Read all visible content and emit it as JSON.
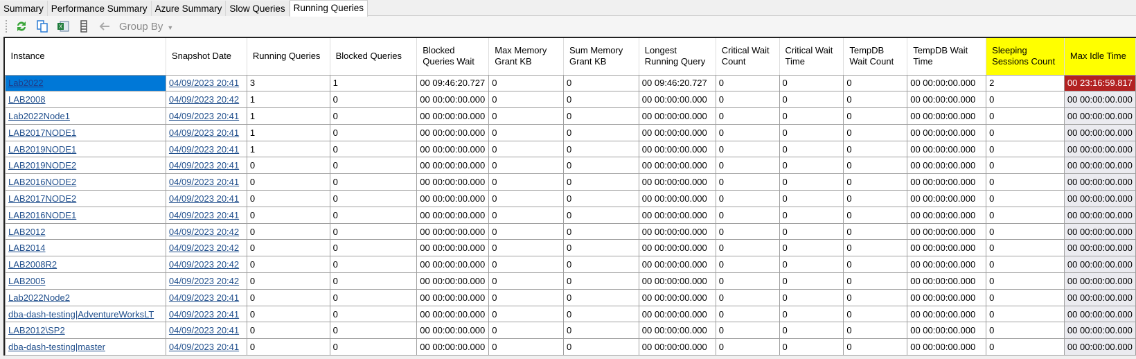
{
  "tabs": [
    {
      "label": "Summary"
    },
    {
      "label": "Performance Summary"
    },
    {
      "label": "Azure Summary"
    },
    {
      "label": "Slow Queries"
    },
    {
      "label": "Running Queries",
      "active": true
    }
  ],
  "toolbar": {
    "icons": [
      "refresh-icon",
      "copy-icon",
      "excel-export-icon",
      "columns-icon",
      "back-arrow-icon"
    ],
    "group_by": "Group By"
  },
  "colors": {
    "highlight_header": "#ffff00",
    "alert_cell": "#b22222",
    "selected_cell": "#0078d7"
  },
  "columns": [
    "Instance",
    "Snapshot Date",
    "Running Queries",
    "Blocked Queries",
    "Blocked Queries Wait",
    "Max Memory Grant KB",
    "Sum Memory Grant KB",
    "Longest Running Query",
    "Critical Wait Count",
    "Critical Wait Time",
    "TempDB Wait Count",
    "TempDB Wait Time",
    "Sleeping Sessions Count",
    "Max Idle Time"
  ],
  "rows": [
    [
      "Lab2022",
      "04/09/2023 20:41",
      "3",
      "1",
      "00 09:46:20.727",
      "0",
      "0",
      "00 09:46:20.727",
      "0",
      "0",
      "0",
      "00 00:00:00.000",
      "2",
      "00 23:16:59.817"
    ],
    [
      "LAB2008",
      "04/09/2023 20:42",
      "1",
      "0",
      "00 00:00:00.000",
      "0",
      "0",
      "00 00:00:00.000",
      "0",
      "0",
      "0",
      "00 00:00:00.000",
      "0",
      "00 00:00:00.000"
    ],
    [
      "Lab2022Node1",
      "04/09/2023 20:41",
      "1",
      "0",
      "00 00:00:00.000",
      "0",
      "0",
      "00 00:00:00.000",
      "0",
      "0",
      "0",
      "00 00:00:00.000",
      "0",
      "00 00:00:00.000"
    ],
    [
      "LAB2017NODE1",
      "04/09/2023 20:41",
      "1",
      "0",
      "00 00:00:00.000",
      "0",
      "0",
      "00 00:00:00.000",
      "0",
      "0",
      "0",
      "00 00:00:00.000",
      "0",
      "00 00:00:00.000"
    ],
    [
      "LAB2019NODE1",
      "04/09/2023 20:41",
      "1",
      "0",
      "00 00:00:00.000",
      "0",
      "0",
      "00 00:00:00.000",
      "0",
      "0",
      "0",
      "00 00:00:00.000",
      "0",
      "00 00:00:00.000"
    ],
    [
      "LAB2019NODE2",
      "04/09/2023 20:41",
      "0",
      "0",
      "00 00:00:00.000",
      "0",
      "0",
      "00 00:00:00.000",
      "0",
      "0",
      "0",
      "00 00:00:00.000",
      "0",
      "00 00:00:00.000"
    ],
    [
      "LAB2016NODE2",
      "04/09/2023 20:41",
      "0",
      "0",
      "00 00:00:00.000",
      "0",
      "0",
      "00 00:00:00.000",
      "0",
      "0",
      "0",
      "00 00:00:00.000",
      "0",
      "00 00:00:00.000"
    ],
    [
      "LAB2017NODE2",
      "04/09/2023 20:41",
      "0",
      "0",
      "00 00:00:00.000",
      "0",
      "0",
      "00 00:00:00.000",
      "0",
      "0",
      "0",
      "00 00:00:00.000",
      "0",
      "00 00:00:00.000"
    ],
    [
      "LAB2016NODE1",
      "04/09/2023 20:41",
      "0",
      "0",
      "00 00:00:00.000",
      "0",
      "0",
      "00 00:00:00.000",
      "0",
      "0",
      "0",
      "00 00:00:00.000",
      "0",
      "00 00:00:00.000"
    ],
    [
      "LAB2012",
      "04/09/2023 20:42",
      "0",
      "0",
      "00 00:00:00.000",
      "0",
      "0",
      "00 00:00:00.000",
      "0",
      "0",
      "0",
      "00 00:00:00.000",
      "0",
      "00 00:00:00.000"
    ],
    [
      "LAB2014",
      "04/09/2023 20:42",
      "0",
      "0",
      "00 00:00:00.000",
      "0",
      "0",
      "00 00:00:00.000",
      "0",
      "0",
      "0",
      "00 00:00:00.000",
      "0",
      "00 00:00:00.000"
    ],
    [
      "LAB2008R2",
      "04/09/2023 20:42",
      "0",
      "0",
      "00 00:00:00.000",
      "0",
      "0",
      "00 00:00:00.000",
      "0",
      "0",
      "0",
      "00 00:00:00.000",
      "0",
      "00 00:00:00.000"
    ],
    [
      "LAB2005",
      "04/09/2023 20:42",
      "0",
      "0",
      "00 00:00:00.000",
      "0",
      "0",
      "00 00:00:00.000",
      "0",
      "0",
      "0",
      "00 00:00:00.000",
      "0",
      "00 00:00:00.000"
    ],
    [
      "Lab2022Node2",
      "04/09/2023 20:41",
      "0",
      "0",
      "00 00:00:00.000",
      "0",
      "0",
      "00 00:00:00.000",
      "0",
      "0",
      "0",
      "00 00:00:00.000",
      "0",
      "00 00:00:00.000"
    ],
    [
      "dba-dash-testing|AdventureWorksLT",
      "04/09/2023 20:41",
      "0",
      "0",
      "00 00:00:00.000",
      "0",
      "0",
      "00 00:00:00.000",
      "0",
      "0",
      "0",
      "00 00:00:00.000",
      "0",
      "00 00:00:00.000"
    ],
    [
      "LAB2012\\SP2",
      "04/09/2023 20:41",
      "0",
      "0",
      "00 00:00:00.000",
      "0",
      "0",
      "00 00:00:00.000",
      "0",
      "0",
      "0",
      "00 00:00:00.000",
      "0",
      "00 00:00:00.000"
    ],
    [
      "dba-dash-testing|master",
      "04/09/2023 20:41",
      "0",
      "0",
      "00 00:00:00.000",
      "0",
      "0",
      "00 00:00:00.000",
      "0",
      "0",
      "0",
      "00 00:00:00.000",
      "0",
      "00 00:00:00.000"
    ]
  ]
}
